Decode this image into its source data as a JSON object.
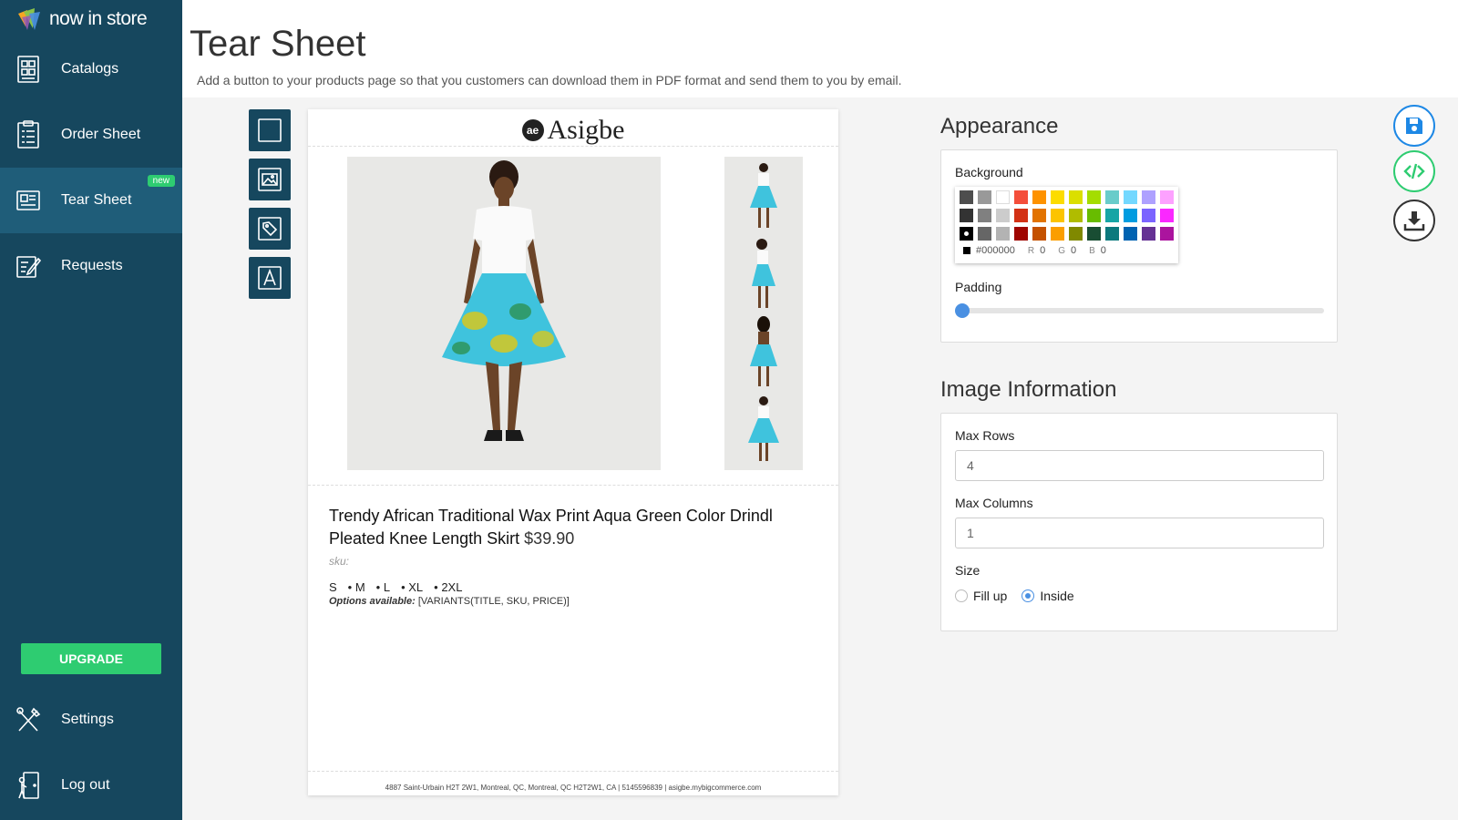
{
  "brand": {
    "name": "now in store"
  },
  "sidebar": {
    "items": [
      {
        "label": "Catalogs",
        "icon": "catalog-icon"
      },
      {
        "label": "Order Sheet",
        "icon": "order-sheet-icon"
      },
      {
        "label": "Tear Sheet",
        "icon": "tear-sheet-icon",
        "badge": "new",
        "active": true
      },
      {
        "label": "Requests",
        "icon": "requests-icon"
      }
    ],
    "upgrade_label": "UPGRADE",
    "bottom_items": [
      {
        "label": "Settings",
        "icon": "settings-tools-icon"
      },
      {
        "label": "Log out",
        "icon": "logout-icon"
      }
    ]
  },
  "header": {
    "title": "Tear Sheet",
    "description": "Add a button to your products page so that you customers can download them in PDF format and send them to you by email."
  },
  "tools": [
    "rectangle-tool-icon",
    "image-tool-icon",
    "tag-tool-icon",
    "text-tool-icon"
  ],
  "preview": {
    "logo_mark": "ae",
    "logo_text": "Asigbe",
    "product_title": "Trendy African Traditional Wax Print Aqua Green Color Drindl Pleated Knee Length Skirt",
    "price": "$39.90",
    "sku_label": "sku:",
    "variants": [
      "S",
      "• M",
      "• L",
      "• XL",
      "• 2XL"
    ],
    "options_label": "Options available:",
    "options_value": "[VARIANTS(TITLE, SKU, PRICE)]",
    "footer": "4887 Saint-Urbain H2T 2W1, Montreal, QC, Montreal, QC H2T2W1, CA | 5145596839 | asigbe.mybigcommerce.com"
  },
  "appearance": {
    "title": "Appearance",
    "background_label": "Background",
    "swatches": [
      "#4d4d4d",
      "#999999",
      "#ffffff",
      "#f44e3b",
      "#fe9200",
      "#fcdc00",
      "#dbdf00",
      "#a4dd00",
      "#68ccca",
      "#73d8ff",
      "#aea1ff",
      "#fda1ff",
      "#333333",
      "#808080",
      "#cccccc",
      "#d33115",
      "#e27300",
      "#fcc400",
      "#b0bc00",
      "#68bc00",
      "#16a5a5",
      "#009ce0",
      "#7b64ff",
      "#fa28ff",
      "#000000",
      "#666666",
      "#b3b3b3",
      "#9f0500",
      "#c45100",
      "#fb9e00",
      "#808900",
      "#194d33",
      "#0c797d",
      "#0062b1",
      "#653294",
      "#ab149e"
    ],
    "selected_color": "#000000",
    "hex_value": "#000000",
    "r_label": "R",
    "r_value": "0",
    "g_label": "G",
    "g_value": "0",
    "b_label": "B",
    "b_value": "0",
    "padding_label": "Padding",
    "padding_value": 0
  },
  "image_info": {
    "title": "Image Information",
    "max_rows_label": "Max Rows",
    "max_rows_value": "4",
    "max_columns_label": "Max Columns",
    "max_columns_value": "1",
    "size_label": "Size",
    "size_options": [
      "Fill up",
      "Inside"
    ],
    "size_selected": "Inside"
  },
  "actions": {
    "save_color": "#1e88e5",
    "embed_color": "#2ecc71",
    "download_color": "#333333"
  }
}
